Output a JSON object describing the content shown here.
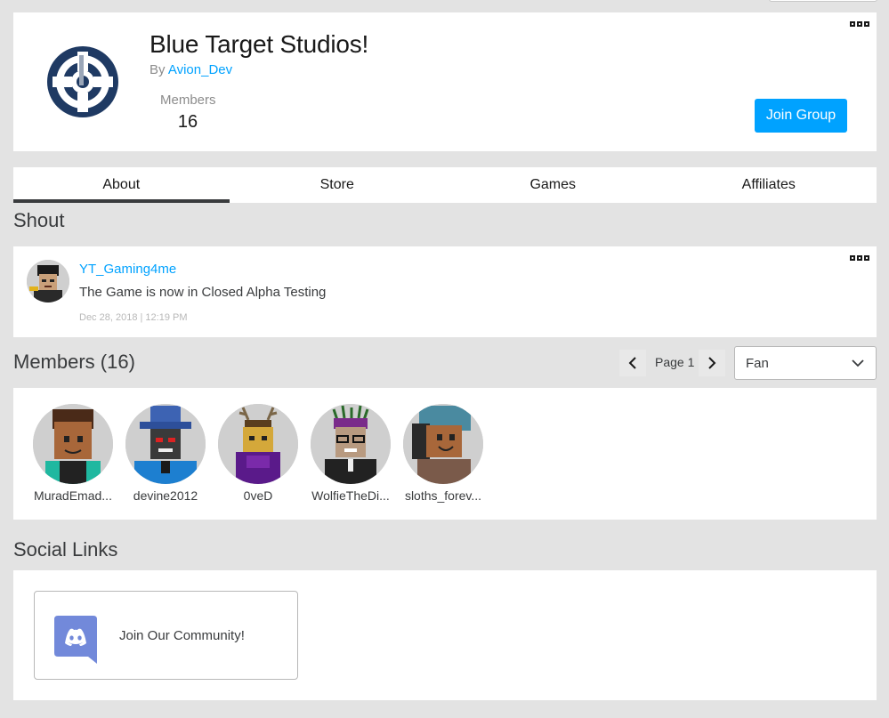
{
  "group": {
    "name": "Blue Target Studios!",
    "by_prefix": "By",
    "owner": "Avion_Dev",
    "members_label": "Members",
    "members_count": "16",
    "join_label": "Join Group"
  },
  "tabs": [
    {
      "label": "About",
      "active": true
    },
    {
      "label": "Store",
      "active": false
    },
    {
      "label": "Games",
      "active": false
    },
    {
      "label": "Affiliates",
      "active": false
    }
  ],
  "shout": {
    "title": "Shout",
    "user": "YT_Gaming4me",
    "text": "The Game is now in Closed Alpha Testing",
    "date": "Dec 28, 2018 | 12:19 PM"
  },
  "members_section": {
    "title": "Members (16)",
    "page_label": "Page 1",
    "role_selected": "Fan",
    "list": [
      {
        "name": "MuradEmad..."
      },
      {
        "name": "devine2012"
      },
      {
        "name": "0veD"
      },
      {
        "name": "WolfieTheDi..."
      },
      {
        "name": "sloths_forev..."
      }
    ]
  },
  "social": {
    "title": "Social Links",
    "discord_label": "Join Our Community!",
    "discord_color": "#7289da"
  },
  "colors": {
    "accent": "#00a2ff",
    "background": "#e3e3e3"
  }
}
